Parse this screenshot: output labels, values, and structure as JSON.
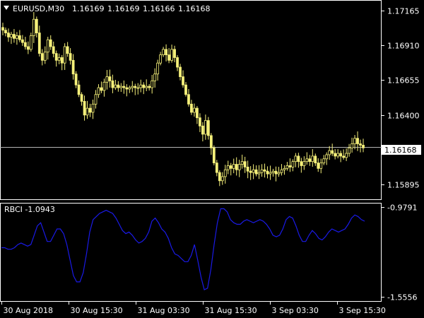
{
  "header": {
    "symbol_label": "EURUSD,M30",
    "open": "1.16169",
    "high": "1.16169",
    "low": "1.16166",
    "close": "1.16168"
  },
  "indicator": {
    "label": "RBCI -1.0943"
  },
  "colors": {
    "background": "#000000",
    "candle": "#f5f07a",
    "indicator_line": "#1a1ae6",
    "axis": "#ffffff",
    "price_line": "#b4b4b4"
  },
  "chart_data": [
    {
      "type": "candlestick",
      "price_axis_ticks": [
        "1.17165",
        "1.16910",
        "1.16655",
        "1.16400",
        "1.16145",
        "1.15895"
      ],
      "current_price_label": "1.16168",
      "ylim": [
        1.158,
        1.1722
      ],
      "current_price": 1.16168,
      "closes": [
        1.1702,
        1.17,
        1.1697,
        1.1699,
        1.1696,
        1.1698,
        1.1695,
        1.1693,
        1.169,
        1.1688,
        1.1698,
        1.171,
        1.17,
        1.1685,
        1.168,
        1.1686,
        1.1695,
        1.169,
        1.1685,
        1.168,
        1.1682,
        1.1678,
        1.169,
        1.1685,
        1.168,
        1.167,
        1.1662,
        1.1655,
        1.165,
        1.164,
        1.1645,
        1.1642,
        1.1648,
        1.1655,
        1.166,
        1.1658,
        1.1664,
        1.1668,
        1.1665,
        1.166,
        1.1662,
        1.166,
        1.1661,
        1.166,
        1.1659,
        1.166,
        1.1661,
        1.166,
        1.166,
        1.1662,
        1.166,
        1.1661,
        1.166,
        1.1665,
        1.167,
        1.1678,
        1.1684,
        1.1688,
        1.1684,
        1.168,
        1.1688,
        1.1682,
        1.1675,
        1.1668,
        1.1662,
        1.1655,
        1.1648,
        1.1642,
        1.1645,
        1.1638,
        1.1632,
        1.1626,
        1.1636,
        1.1625,
        1.1616,
        1.1605,
        1.1598,
        1.1592,
        1.1595,
        1.16,
        1.1603,
        1.1601,
        1.1604,
        1.16,
        1.1604,
        1.1606,
        1.1602,
        1.1599,
        1.1598,
        1.16,
        1.1597,
        1.1598,
        1.16,
        1.1599,
        1.1597,
        1.1598,
        1.1599,
        1.1597,
        1.1598,
        1.16,
        1.1601,
        1.1603,
        1.1602,
        1.1606,
        1.161,
        1.1606,
        1.1603,
        1.1606,
        1.1608,
        1.1606,
        1.161,
        1.1605,
        1.1601,
        1.1605,
        1.1608,
        1.1611,
        1.1614,
        1.1612,
        1.161,
        1.1612,
        1.161,
        1.1609,
        1.1612,
        1.1616,
        1.1619,
        1.1623,
        1.1619,
        1.1618,
        1.1616
      ]
    },
    {
      "type": "line",
      "name": "RBCI",
      "label": "RBCI -1.0943",
      "ylim": [
        -1.5556,
        -0.9791
      ],
      "axis_ticks": [
        "-0.9791",
        "-1.5556"
      ],
      "values": [
        -1.24,
        -1.24,
        -1.25,
        -1.25,
        -1.24,
        -1.22,
        -1.21,
        -1.22,
        -1.23,
        -1.22,
        -1.16,
        -1.1,
        -1.08,
        -1.14,
        -1.2,
        -1.2,
        -1.16,
        -1.12,
        -1.12,
        -1.15,
        -1.22,
        -1.32,
        -1.42,
        -1.46,
        -1.46,
        -1.4,
        -1.28,
        -1.14,
        -1.06,
        -1.04,
        -1.02,
        -1.01,
        -1.0,
        -1.01,
        -1.02,
        -1.05,
        -1.09,
        -1.13,
        -1.15,
        -1.14,
        -1.16,
        -1.19,
        -1.21,
        -1.2,
        -1.18,
        -1.14,
        -1.07,
        -1.05,
        -1.08,
        -1.12,
        -1.14,
        -1.18,
        -1.24,
        -1.28,
        -1.29,
        -1.31,
        -1.33,
        -1.33,
        -1.29,
        -1.22,
        -1.32,
        -1.43,
        -1.51,
        -1.5,
        -1.38,
        -1.22,
        -1.08,
        -0.99,
        -0.99,
        -1.01,
        -1.06,
        -1.08,
        -1.09,
        -1.09,
        -1.07,
        -1.06,
        -1.07,
        -1.08,
        -1.07,
        -1.06,
        -1.07,
        -1.09,
        -1.12,
        -1.16,
        -1.17,
        -1.16,
        -1.12,
        -1.06,
        -1.04,
        -1.05,
        -1.1,
        -1.16,
        -1.2,
        -1.2,
        -1.16,
        -1.13,
        -1.15,
        -1.18,
        -1.19,
        -1.17,
        -1.14,
        -1.12,
        -1.13,
        -1.14,
        -1.13,
        -1.12,
        -1.09,
        -1.05,
        -1.03,
        -1.04,
        -1.06,
        -1.07
      ]
    }
  ],
  "time_axis": {
    "labels": [
      "30 Aug 2018",
      "30 Aug 15:30",
      "31 Aug 03:30",
      "31 Aug 15:30",
      "3 Sep 03:30",
      "3 Sep 15:30"
    ]
  }
}
